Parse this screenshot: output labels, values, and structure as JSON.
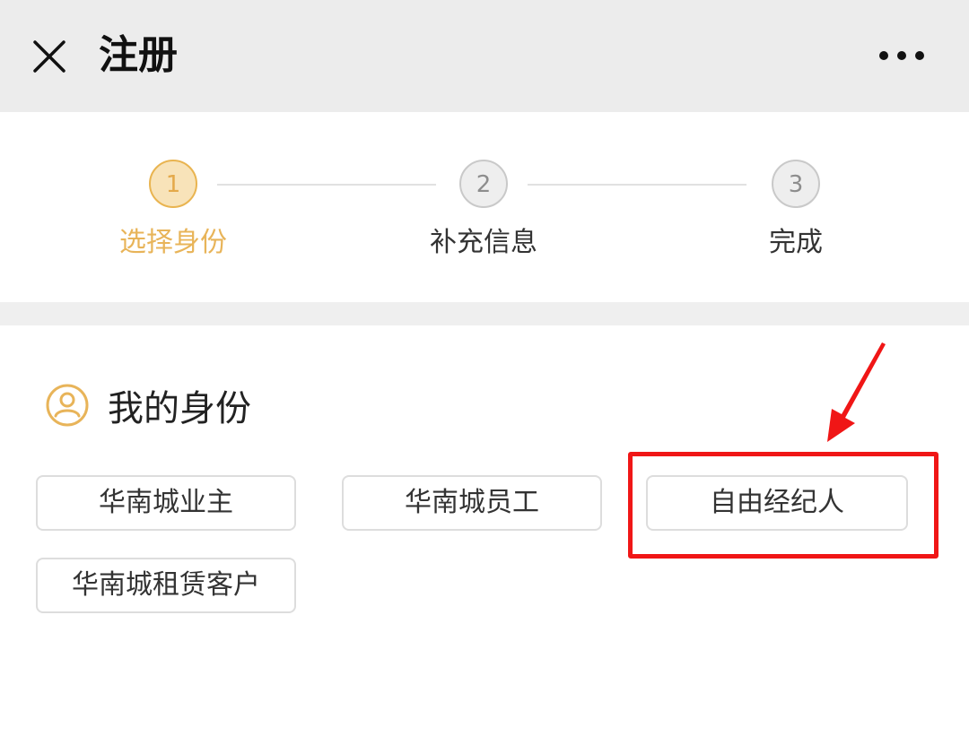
{
  "header": {
    "title": "注册",
    "close_icon": "close-icon",
    "more_icon": "more-dots-icon"
  },
  "steps": [
    {
      "number": "1",
      "label": "选择身份",
      "state": "active"
    },
    {
      "number": "2",
      "label": "补充信息",
      "state": "inactive"
    },
    {
      "number": "3",
      "label": "完成",
      "state": "inactive"
    }
  ],
  "identity": {
    "icon": "user-icon",
    "title": "我的身份",
    "options": [
      {
        "label": "华南城业主",
        "highlighted": false
      },
      {
        "label": "华南城员工",
        "highlighted": false
      },
      {
        "label": "自由经纪人",
        "highlighted": true
      },
      {
        "label": "华南城租赁客户",
        "highlighted": false
      }
    ]
  },
  "colors": {
    "active_step": "#e8b459",
    "highlight": "#f01616",
    "header_bg": "#ececec"
  }
}
